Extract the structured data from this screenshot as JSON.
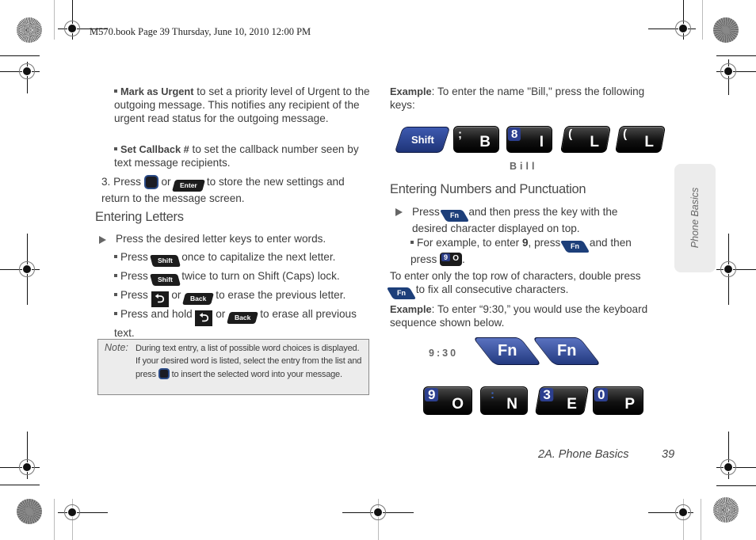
{
  "slug": "M570.book  Page 39  Thursday, June 10, 2010  12:00 PM",
  "left_column": {
    "bullets_top": [
      {
        "bold": "Mark as Urgent",
        "text": " to set a priority level of Urgent to the outgoing message. This notifies any recipient of the urgent read status for the outgoing message."
      },
      {
        "bold": "Set Callback #",
        "text": " to set the callback number seen by text message recipients."
      }
    ],
    "step3": {
      "number": "3.",
      "pre": "Press",
      "or": "or",
      "post": "to store the new settings and return to the message screen.",
      "key2_label": "Enter"
    },
    "heading": "Entering Letters",
    "main_item": "Press the desired letter keys to enter words.",
    "sub_items": [
      {
        "pre": "Press",
        "key": "Shift",
        "post": "once to capitalize the next letter."
      },
      {
        "pre": "Press",
        "key": "Shift",
        "post": "twice to turn on Shift (Caps) lock."
      },
      {
        "pre": "Press",
        "or": "or",
        "key2": "Back",
        "post": "to erase the previous letter."
      },
      {
        "pre": "Press and hold",
        "or": "or",
        "key2": "Back",
        "post": "to erase all previous text."
      }
    ],
    "note": {
      "label": "Note:",
      "text_pre": "During text entry, a list of possible word choices is displayed. If your desired word is listed, select the entry from the list and press",
      "text_post": "to insert the selected word into your message."
    }
  },
  "right_column": {
    "example1": {
      "label": "Example",
      "text": ": To enter the name \"Bill,\" press the following keys:"
    },
    "bill_keys": [
      {
        "type": "shift",
        "label": "Shift"
      },
      {
        "top": ";",
        "bottom": "B",
        "top_blue": false
      },
      {
        "top": "8",
        "bottom": "I",
        "top_blue": true
      },
      {
        "top": "(",
        "bottom": "L",
        "top_blue": false
      },
      {
        "top": "(",
        "bottom": "L",
        "top_blue": false
      }
    ],
    "bill_caption": "Bill",
    "heading": "Entering Numbers and Punctuation",
    "main_item": {
      "pre": "Press",
      "key": "Fn",
      "post": "and then press the key with the desired character displayed on top."
    },
    "sub_item": {
      "pre": "For example, to enter ",
      "bold": "9",
      "mid": ", press",
      "key": "Fn",
      "post": "and then press",
      "key2_top": "9",
      "key2_bottom": "O",
      "end": "."
    },
    "para": {
      "pre": "To enter only the top row of characters, double press",
      "key": "Fn",
      "post": "to fix all consecutive characters."
    },
    "example2": {
      "label": "Example",
      "text": ": To enter “9:30,” you would use the keyboard sequence shown below."
    },
    "time_caption": "9:30",
    "fn_keys": [
      "Fn",
      "Fn"
    ],
    "time_keys": [
      {
        "top": "9",
        "bottom": "O"
      },
      {
        "top": ":",
        "bottom": "N"
      },
      {
        "top": "3",
        "bottom": "E"
      },
      {
        "top": "0",
        "bottom": "P"
      }
    ]
  },
  "side_tab": "Phone Basics",
  "footer": {
    "section": "2A. Phone Basics",
    "page": "39"
  },
  "colors": {
    "key_blue": "#2c3f8f",
    "fn_blue": "#1d3f7a",
    "tab_gray": "#ececec"
  }
}
